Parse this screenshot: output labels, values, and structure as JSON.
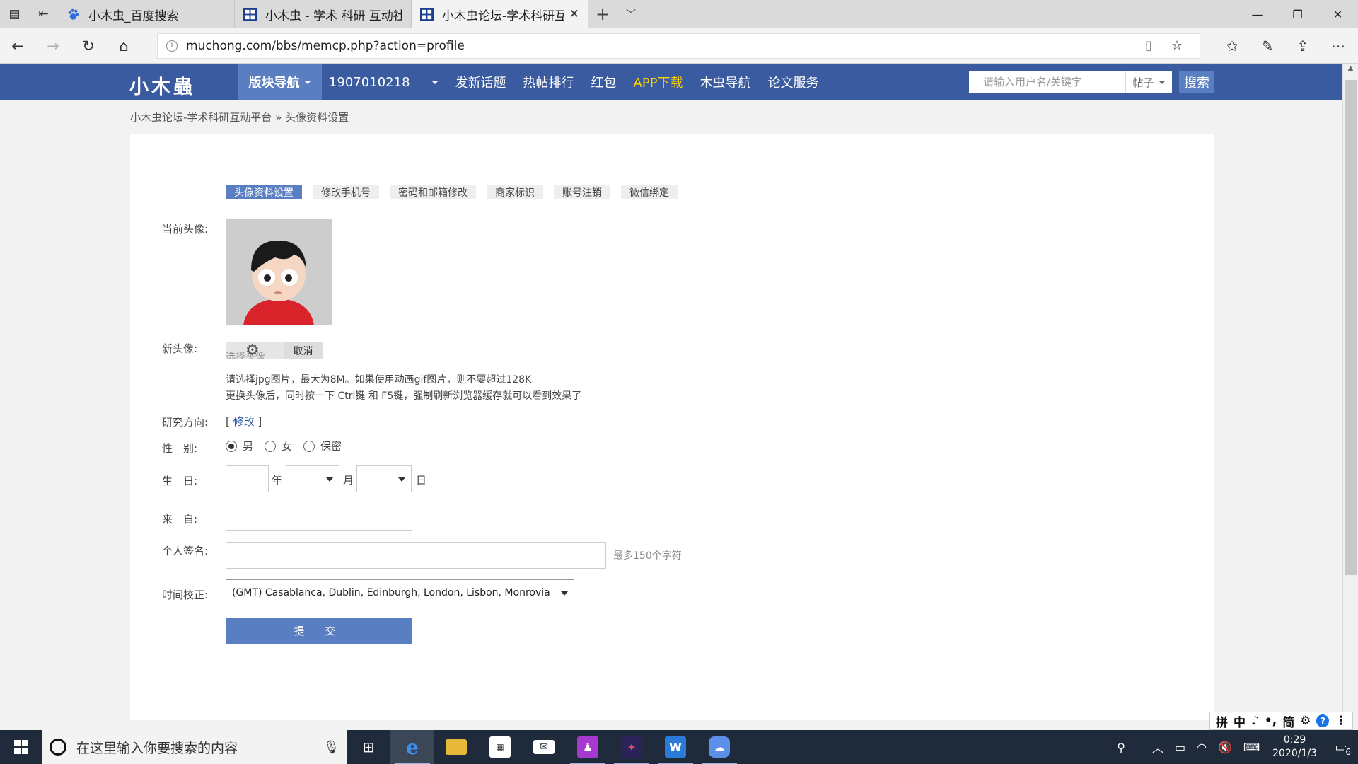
{
  "browser": {
    "tabs": [
      {
        "title": "小木虫_百度搜索",
        "icon": "baidu-paw-icon"
      },
      {
        "title": "小木虫 - 学术 科研 互动社区",
        "icon": "muchong-grid-icon"
      },
      {
        "title": "小木虫论坛-学术科研互",
        "icon": "muchong-grid-icon",
        "active": true
      }
    ],
    "url": "muchong.com/bbs/memcp.php?action=profile"
  },
  "site": {
    "logo": "小木蟲",
    "nav_drop": "版块导航",
    "user": "1907010218",
    "nav": [
      "发新话题",
      "热帖排行",
      "红包",
      "APP下载",
      "木虫导航",
      "论文服务"
    ],
    "search_placeholder": "请输入用户名/关键字",
    "search_type": "帖子",
    "search_button": "搜索"
  },
  "breadcrumb": {
    "home": "小木虫论坛-学术科研互动平台",
    "sep": "»",
    "current": "头像资料设置"
  },
  "profile_tabs": [
    "头像资料设置",
    "修改手机号",
    "密码和邮箱修改",
    "商家标识",
    "账号注销",
    "微信绑定"
  ],
  "form": {
    "current_avatar_label": "当前头像:",
    "new_avatar_label": "新头像:",
    "file_button": "选择头像",
    "cancel": "取消",
    "tip1": "请选择jpg图片，最大为8M。如果使用动画gif图片，则不要超过128K",
    "tip2": "更换头像后，同时按一下 Ctrl键 和 F5键，强制刷新浏览器缓存就可以看到效果了",
    "research_label": "研究方向:",
    "research_link_open": "[ ",
    "research_link": "修改",
    "research_link_close": " ]",
    "gender_label": "性　别:",
    "gender_options": [
      "男",
      "女",
      "保密"
    ],
    "gender_selected": "男",
    "birthday_label": "生　日:",
    "year_unit": "年",
    "month_unit": "月",
    "day_unit": "日",
    "from_label": "来　自:",
    "signature_label": "个人签名:",
    "signature_hint": "最多150个字符",
    "timezone_label": "时间校正:",
    "timezone_value": "(GMT) Casablanca, Dublin, Edinburgh, London, Lisbon, Monrovia",
    "submit": "提 交"
  },
  "ime": [
    "拼",
    "中",
    "♪",
    "•,",
    "简",
    "⚙",
    "?",
    "⋮"
  ],
  "taskbar": {
    "search_placeholder": "在这里输入你要搜索的内容",
    "time": "0:29",
    "date": "2020/1/3",
    "notifications": "6"
  }
}
